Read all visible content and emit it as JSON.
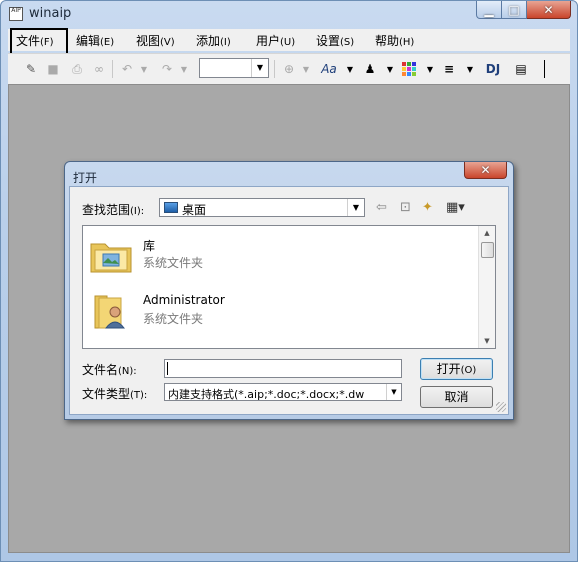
{
  "window": {
    "title": "winaip"
  },
  "menu": [
    {
      "label": "文件",
      "accel": "(F)"
    },
    {
      "label": "编辑",
      "accel": "(E)"
    },
    {
      "label": "视图",
      "accel": "(V)"
    },
    {
      "label": "添加",
      "accel": "(I)"
    },
    {
      "label": "用户",
      "accel": "(U)"
    },
    {
      "label": "设置",
      "accel": "(S)"
    },
    {
      "label": "帮助",
      "accel": "(H)"
    }
  ],
  "toolbar": {
    "font_style_label": "Aa",
    "dj_label": "DJ",
    "zoom_value": ""
  },
  "dialog": {
    "title": "打开",
    "look_in_label": "查找范围",
    "look_in_accel": "(I):",
    "look_in_value": "桌面",
    "files": [
      {
        "name": "库",
        "type": "系统文件夹",
        "icon": "library-folder-icon"
      },
      {
        "name": "Administrator",
        "type": "系统文件夹",
        "icon": "user-folder-icon"
      }
    ],
    "filename_label": "文件名",
    "filename_accel": "(N):",
    "filename_value": "",
    "filetype_label": "文件类型",
    "filetype_accel": "(T):",
    "filetype_value": "内建支持格式(*.aip;*.doc;*.docx;*.dw",
    "open_button": "打开",
    "open_accel": "(O)",
    "cancel_button": "取消"
  }
}
